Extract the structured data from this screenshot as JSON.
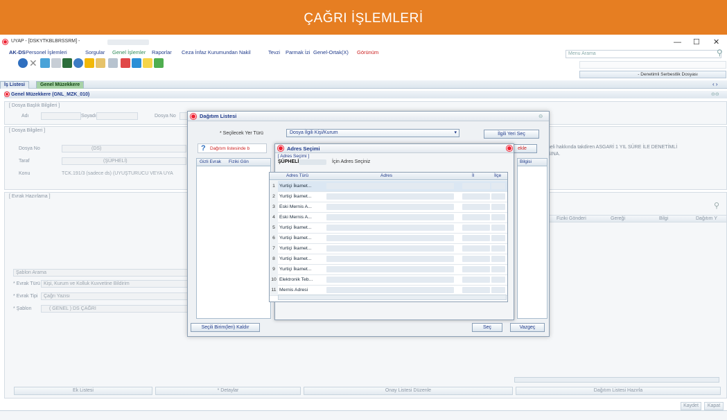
{
  "banner": {
    "title": "ÇAĞRI İŞLEMLERİ"
  },
  "window": {
    "title": "UYAP - [DSKYTKBLBRSSRM] -",
    "minimize": "—",
    "maximize": "☐",
    "close": "✕"
  },
  "menu": {
    "items": [
      "AK-DS",
      "Personel İşlemleri",
      "Sorgular",
      "Genel İşlemler",
      "Raporlar",
      "Ceza İnfaz Kurumundan Nakil",
      "Tevzi",
      "Parmak İzi",
      "Genel-Ortak(X)",
      "Görünüm"
    ],
    "search_placeholder": "Menu Arama"
  },
  "dossier_select": "- Denetimli Serbestlik Dosyası",
  "tabs": [
    "İş Listesi",
    "Genel Müzekkere"
  ],
  "panel": {
    "title": "Genel Müzekkere (GNL_MZK_010)"
  },
  "dosya_baslik": {
    "title": "[ Dosya Başlık Bilgileri ]",
    "adi": "Adı",
    "soyadi": "Soyadı",
    "dosya_no": "Dosya No"
  },
  "dosya_bilgileri": {
    "title": "[ Dosya Bilgileri ]",
    "dosya_no_label": "Dosya No",
    "dosya_no_val": "(DS)",
    "taraf_label": "Taraf",
    "taraf_val": "(ŞÜPHELİ)",
    "konu_label": "Konu",
    "konu_val": "TCK.191/3 (sadece ds) (UYUŞTURUCU VEYA UYA",
    "right_note_1": "heli hakkında takdiren ASGARİ 1 YIL SÜRE İLE DENETİMLİ",
    "right_note_2": "SINA."
  },
  "evrak": {
    "title": "[ Evrak Hazırlama ]",
    "sablon_arama": "Şablon Arama",
    "evrak_turu_label": "* Evrak Türü",
    "evrak_turu_val": "Kişi, Kurum ve Kolluk Kuvvetine Bildirim",
    "evrak_tipi_label": "* Evrak Tipi",
    "evrak_tipi_val": "Çağrı Yazısı",
    "sablon_label": "* Şablon",
    "sablon_val": "( GENEL ) DS ÇAĞRI"
  },
  "right_table_headers": [
    "Fiziki Gönderi",
    "Gereği",
    "Bilgi",
    "Dağıtım Y"
  ],
  "bottom_buttons": [
    "Ek Listesi",
    "* Detaylar",
    "Onay Listesi Düzenle",
    "Dağıtım Listesi Hazırla"
  ],
  "footer_buttons": [
    "Kaydet",
    "Kapat"
  ],
  "dagitim_dialog": {
    "title": "Dağıtım Listesi",
    "secilecek_label": "* Seçilecek Yer Türü",
    "secilecek_val": "Dosya İlgili Kişi/Kurum",
    "ilgili_yeri_sec": "İlgili Yeri Seç",
    "info_text": "Dağıtım listesinde b",
    "ekle_btn": "ekle",
    "table_headers": [
      "Gizli Evrak",
      "Fiziki Gön",
      "Bilgisi"
    ],
    "secili_kaldir": "Seçili Birim(leri) Kaldır",
    "sec": "Seç",
    "vazgec": "Vazgeç"
  },
  "adres_dialog": {
    "title": "Adres Seçimi",
    "subtitle": "[ Adres Seçimi ]",
    "party": "ŞÜPHELİ",
    "for_label": "İçin Adres Seçiniz",
    "headers": [
      "Adres Türü",
      "Adres",
      "İl",
      "İlçe"
    ],
    "rows": [
      {
        "n": "1",
        "type": "Yurtiçi İkamet..."
      },
      {
        "n": "2",
        "type": "Yurtiçi İkamet..."
      },
      {
        "n": "3",
        "type": "Eski Mernis A..."
      },
      {
        "n": "4",
        "type": "Eski Mernis A..."
      },
      {
        "n": "5",
        "type": "Yurtiçi İkamet..."
      },
      {
        "n": "6",
        "type": "Yurtiçi İkamet..."
      },
      {
        "n": "7",
        "type": "Yurtiçi İkamet..."
      },
      {
        "n": "8",
        "type": "Yurtiçi İkamet..."
      },
      {
        "n": "9",
        "type": "Yurtiçi İkamet..."
      },
      {
        "n": "10",
        "type": "Elektronik Teb..."
      },
      {
        "n": "11",
        "type": "Mernis Adresi"
      }
    ]
  }
}
